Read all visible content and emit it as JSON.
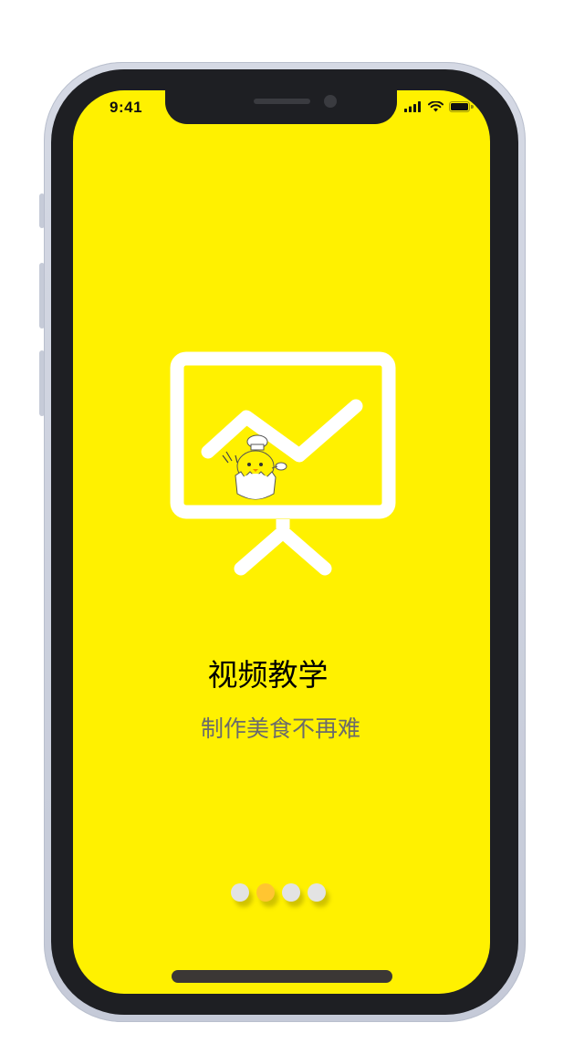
{
  "status_bar": {
    "time": "9:41"
  },
  "onboarding": {
    "title": "视频教学",
    "subtitle": "制作美食不再难",
    "page_count": 4,
    "active_page": 2
  },
  "icons": {
    "hero": "presentation-chart-icon",
    "mascot": "chick-chef-icon",
    "signal": "signal-bars-icon",
    "wifi": "wifi-icon",
    "battery": "battery-icon"
  },
  "colors": {
    "background": "#fff100",
    "active_dot": "#ffc531",
    "inactive_dot": "#e3e3e3",
    "title": "#000000",
    "subtitle": "#6b6b6b"
  }
}
